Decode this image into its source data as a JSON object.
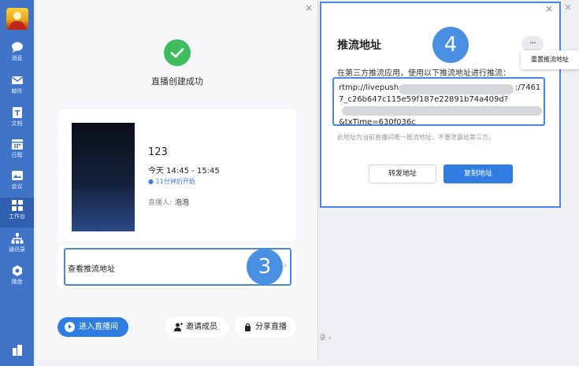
{
  "sidebar": {
    "items": [
      {
        "label": "消息",
        "icon": "chat-bubble-icon"
      },
      {
        "label": "邮件",
        "icon": "mail-icon"
      },
      {
        "label": "文档",
        "icon": "document-icon"
      },
      {
        "label": "日程",
        "icon": "calendar-icon"
      },
      {
        "label": "会议",
        "icon": "meeting-icon"
      },
      {
        "label": "工作台",
        "icon": "grid-icon"
      },
      {
        "label": "通讯录",
        "icon": "contacts-icon"
      },
      {
        "label": "微盘",
        "icon": "cloud-drive-icon"
      }
    ],
    "active": "工作台"
  },
  "live_dialog": {
    "close": "×",
    "success_text": "直播创建成功",
    "live_name": "123",
    "time_range": "今天 14:45 - 15:45",
    "countdown": "● 11分钟后开始",
    "host_label": "直播人:",
    "host_name": "泡泡",
    "view_address_label": "查看推流地址",
    "view_address_arrow": "›",
    "step_badge": "3",
    "enter_button": "进入直播间",
    "invite_button": "邀请成员",
    "share_button": "分享直播"
  },
  "stream_dialog": {
    "close": "×",
    "title": "推流地址",
    "more": "···",
    "step_badge": "4",
    "description": "在第三方推流应用，使用以下推流地址进行推流：",
    "url_line1_start": "rtmp://livepush.",
    "url_line1_end": ":/7461",
    "url_line2": "7_c26b647c115e59f187e22891b74a409d?",
    "url_line3": "&txTime=630f036c",
    "note": "此地址为当前直播间唯一推流地址，不要泄露给第三方。",
    "forward_button": "转发地址",
    "copy_button": "复制地址",
    "reset_menu": "重置推流地址"
  },
  "background": {
    "close": "×",
    "partial_text": "录 ›"
  },
  "colors": {
    "sidebar": "#3f74c9",
    "accent": "#2f7de1",
    "success": "#3fbd5c",
    "badge": "#4a90e2",
    "highlight": "#4a86e8"
  }
}
